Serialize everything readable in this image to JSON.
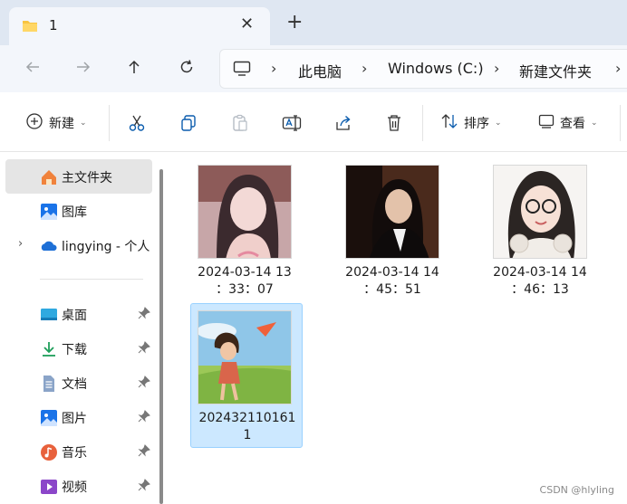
{
  "tab": {
    "title": "1",
    "close_icon": "close-icon",
    "new_tab_icon": "plus-icon"
  },
  "nav": {
    "back_icon": "arrow-left-icon",
    "forward_icon": "arrow-right-icon",
    "up_icon": "arrow-up-icon",
    "refresh_icon": "refresh-icon"
  },
  "address": {
    "breadcrumbs": [
      "此电脑",
      "Windows (C:)",
      "新建文件夹"
    ]
  },
  "toolbar": {
    "new_label": "新建",
    "sort_label": "排序",
    "view_label": "查看"
  },
  "sidebar": {
    "items": [
      {
        "label": "主文件夹",
        "icon": "home-icon"
      },
      {
        "label": "图库",
        "icon": "gallery-icon"
      },
      {
        "label": "lingying - 个人",
        "icon": "onedrive-cloud-icon"
      },
      {
        "label": "桌面",
        "icon": "desktop-icon"
      },
      {
        "label": "下载",
        "icon": "download-icon"
      },
      {
        "label": "文档",
        "icon": "document-icon"
      },
      {
        "label": "图片",
        "icon": "pictures-icon"
      },
      {
        "label": "音乐",
        "icon": "music-icon"
      },
      {
        "label": "视频",
        "icon": "video-icon"
      }
    ]
  },
  "files": [
    {
      "name": "2024-03-14 13\n：33：07"
    },
    {
      "name": "2024-03-14 14\n：45：51"
    },
    {
      "name": "2024-03-14 14\n：46：13"
    },
    {
      "name": "202432110161\n1"
    }
  ],
  "watermark": "CSDN @hlyling",
  "colors": {
    "selection": "#cce8ff",
    "selection_border": "#99d1ff",
    "accent": "#0067c0"
  }
}
